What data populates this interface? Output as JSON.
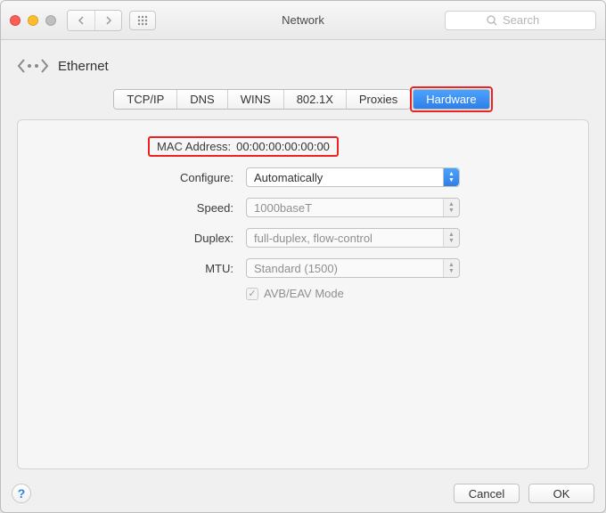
{
  "window": {
    "title": "Network"
  },
  "search": {
    "placeholder": "Search"
  },
  "header": {
    "connection": "Ethernet"
  },
  "tabs": {
    "items": [
      {
        "label": "TCP/IP",
        "active": false
      },
      {
        "label": "DNS",
        "active": false
      },
      {
        "label": "WINS",
        "active": false
      },
      {
        "label": "802.1X",
        "active": false
      },
      {
        "label": "Proxies",
        "active": false
      },
      {
        "label": "Hardware",
        "active": true
      }
    ]
  },
  "form": {
    "mac_label": "MAC Address:",
    "mac_value": "00:00:00:00:00:00",
    "configure_label": "Configure:",
    "configure_value": "Automatically",
    "speed_label": "Speed:",
    "speed_value": "1000baseT",
    "duplex_label": "Duplex:",
    "duplex_value": "full-duplex, flow-control",
    "mtu_label": "MTU:",
    "mtu_value": "Standard  (1500)",
    "avb_label": "AVB/EAV Mode",
    "avb_checked": true
  },
  "buttons": {
    "cancel": "Cancel",
    "ok": "OK"
  }
}
